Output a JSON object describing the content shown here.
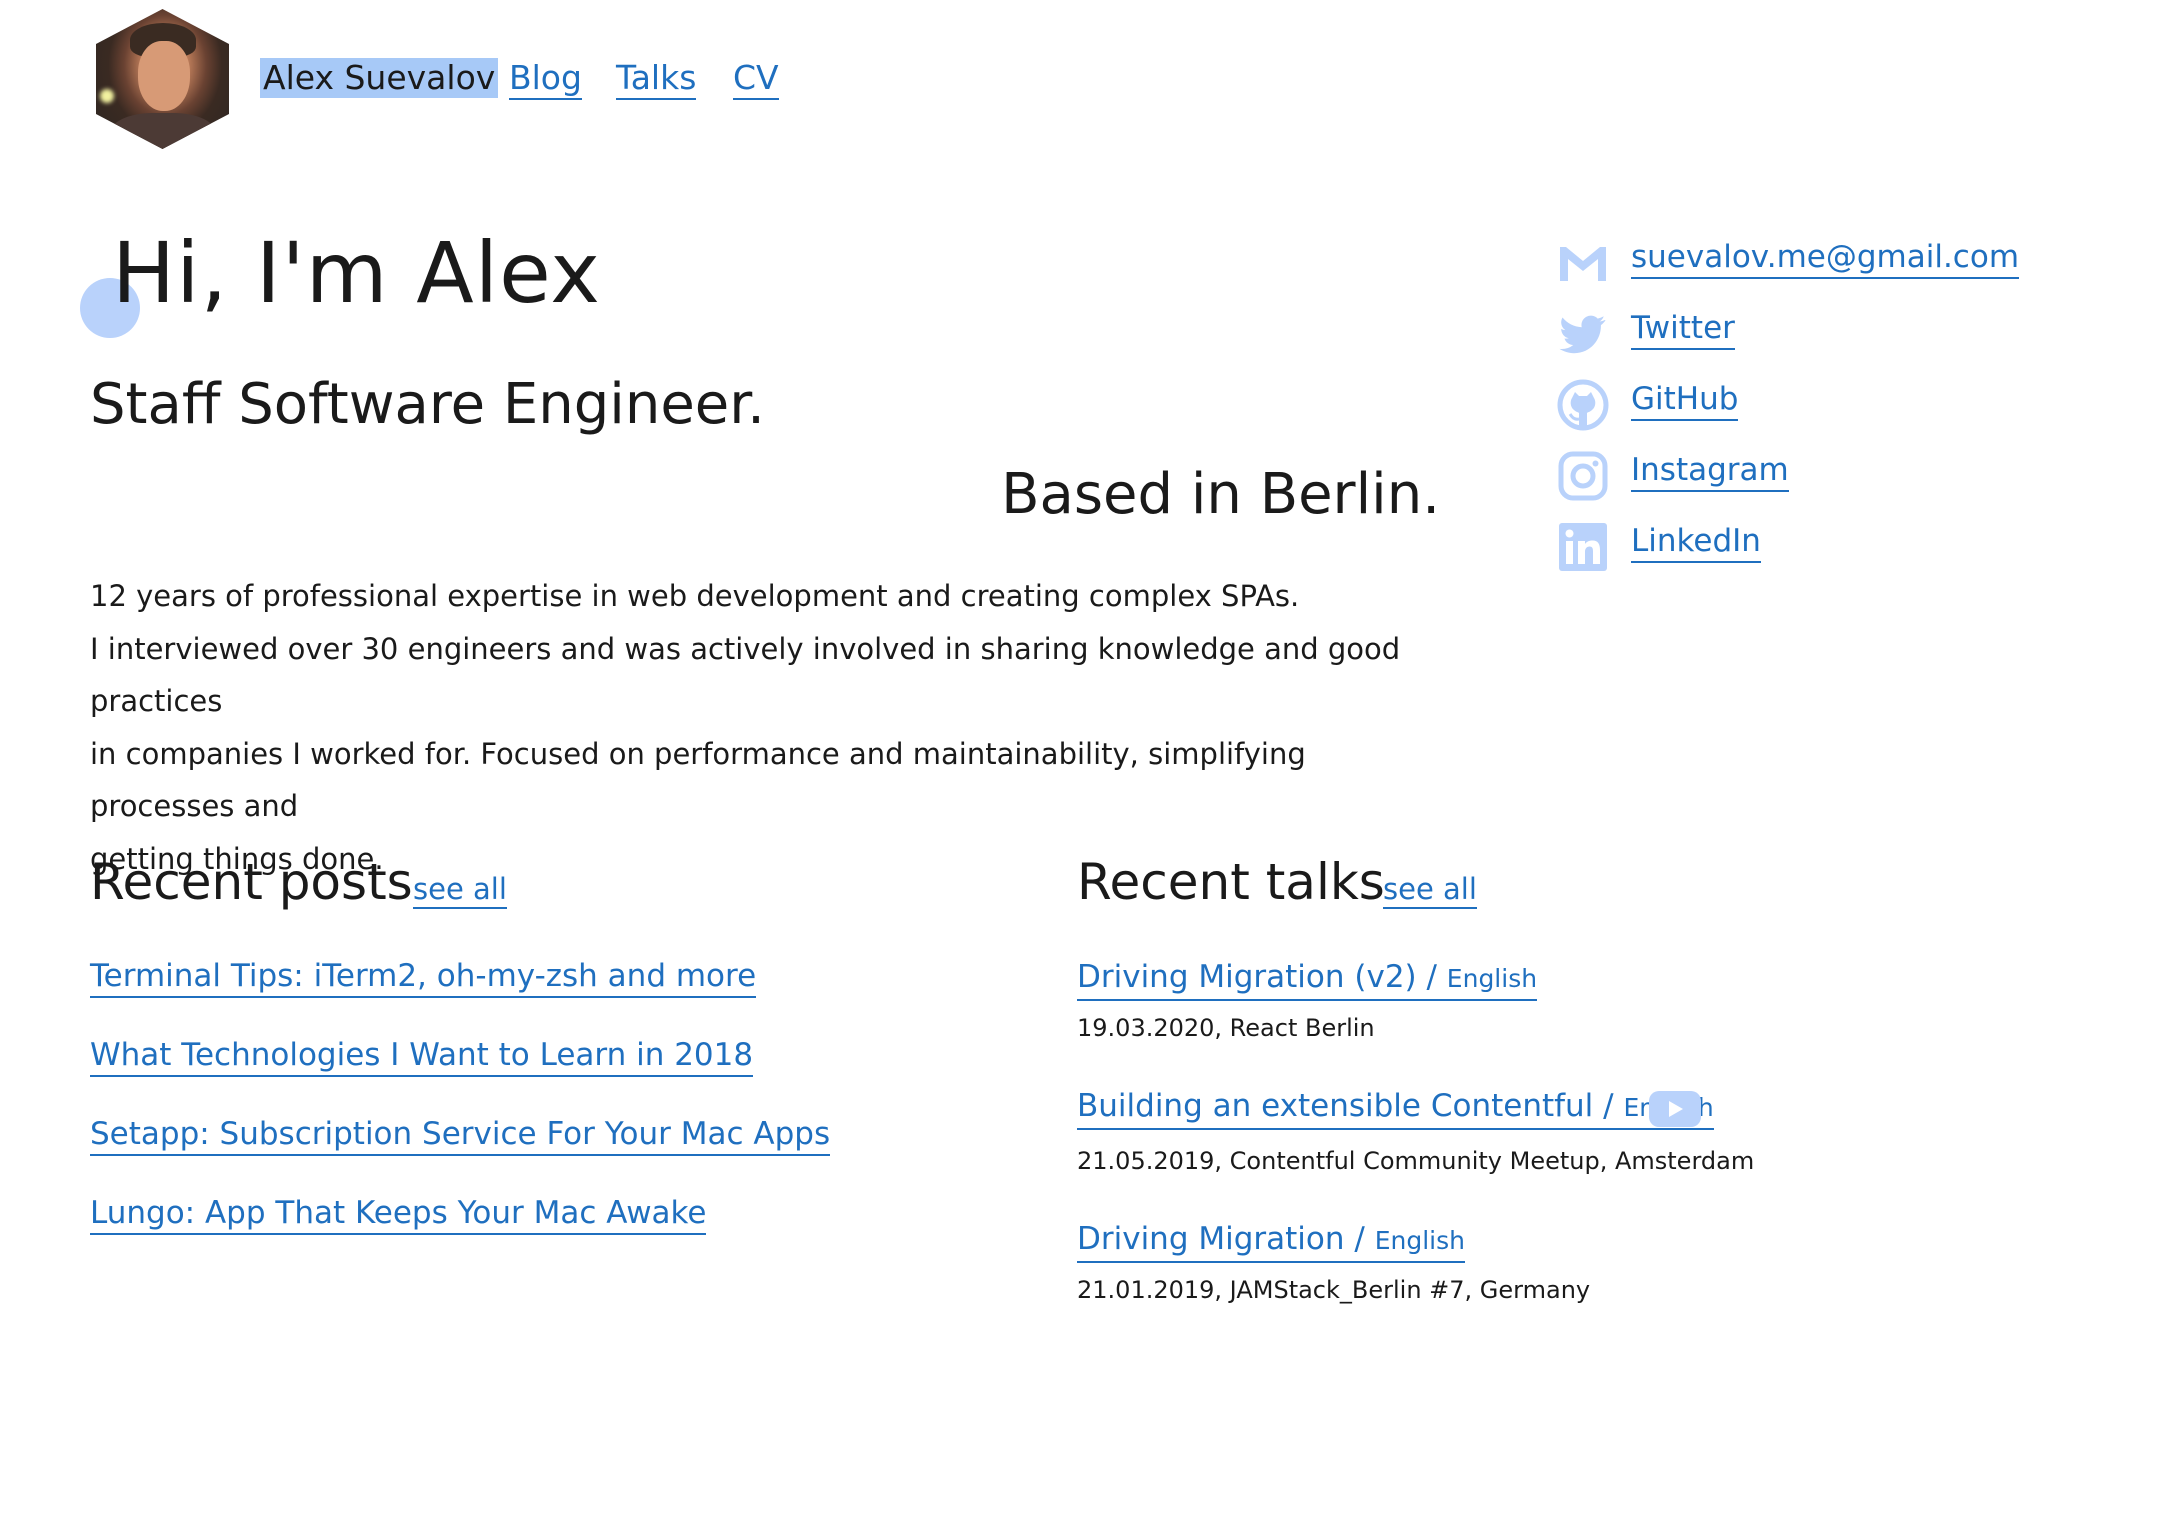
{
  "header": {
    "name": "Alex Suevalov",
    "nav": [
      "Blog",
      "Talks",
      "CV"
    ]
  },
  "hero": {
    "greeting": "Hi, I'm Alex",
    "role": "Staff Software Engineer.",
    "location": "Based in Berlin.",
    "bio_lines": [
      "12 years of professional expertise in web development and creating complex SPAs.",
      "I interviewed over 30 engineers and was actively involved in sharing knowledge and good practices",
      "in companies I worked for. Focused on performance and maintainability, simplifying processes and",
      "getting things done."
    ]
  },
  "contacts": [
    {
      "icon": "gmail-icon",
      "label": "suevalov.me@gmail.com"
    },
    {
      "icon": "twitter-icon",
      "label": "Twitter"
    },
    {
      "icon": "github-icon",
      "label": "GitHub"
    },
    {
      "icon": "instagram-icon",
      "label": "Instagram"
    },
    {
      "icon": "linkedin-icon",
      "label": "LinkedIn"
    }
  ],
  "posts": {
    "title": "Recent posts",
    "see_all": "see all",
    "items": [
      "Terminal Tips: iTerm2, oh-my-zsh and more",
      "What Technologies I Want to Learn in 2018",
      "Setapp: Subscription Service For Your Mac Apps",
      "Lungo: App That Keeps Your Mac Awake"
    ]
  },
  "talks": {
    "title": "Recent talks",
    "see_all": "see all",
    "items": [
      {
        "title": "Driving Migration (v2) / ",
        "lang": "English",
        "meta": "19.03.2020, React Berlin",
        "video": false
      },
      {
        "title": "Building an extensible Contentful / ",
        "lang": "English",
        "meta": "21.05.2019, Contentful Community Meetup, Amsterdam",
        "video": true
      },
      {
        "title": "Driving Migration / ",
        "lang": "English",
        "meta": "21.01.2019, JAMStack_Berlin #7, Germany",
        "video": false
      }
    ]
  },
  "colors": {
    "link": "#1f6fbf",
    "icon": "#b9d2fb",
    "selection": "#a7c9f7"
  }
}
